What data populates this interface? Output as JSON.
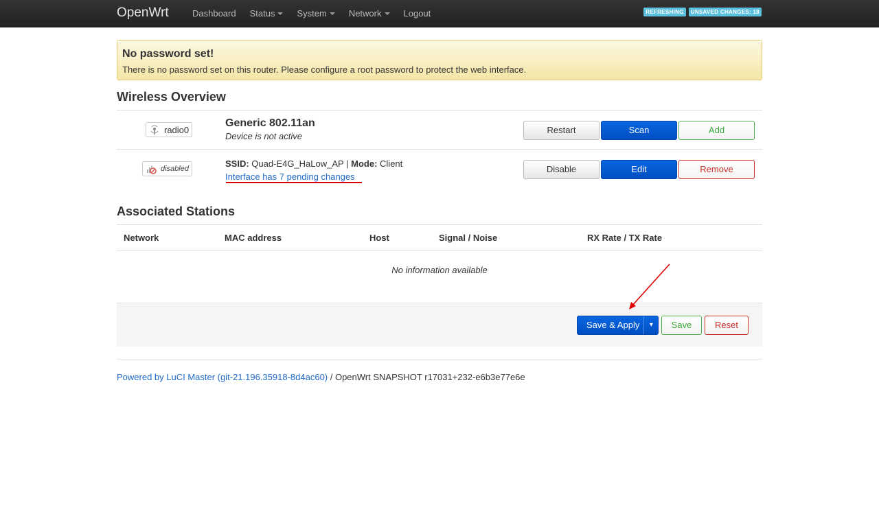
{
  "navbar": {
    "brand": "OpenWrt",
    "items": [
      {
        "label": "Dashboard",
        "dropdown": false
      },
      {
        "label": "Status",
        "dropdown": true
      },
      {
        "label": "System",
        "dropdown": true
      },
      {
        "label": "Network",
        "dropdown": true
      },
      {
        "label": "Logout",
        "dropdown": false
      }
    ],
    "indicators": {
      "refreshing": "REFRESHING",
      "unsaved": "UNSAVED CHANGES: 18"
    }
  },
  "alert": {
    "title": "No password set!",
    "message": "There is no password set on this router. Please configure a root password to protect the web interface."
  },
  "wireless": {
    "heading": "Wireless Overview",
    "radio": {
      "badge": "radio0",
      "title": "Generic 802.11an",
      "status": "Device is not active",
      "buttons": {
        "restart": "Restart",
        "scan": "Scan",
        "add": "Add"
      }
    },
    "iface": {
      "badge": "disabled",
      "ssid_label": "SSID:",
      "ssid": "Quad-E4G_HaLow_AP",
      "sep": "|",
      "mode_label": "Mode:",
      "mode": "Client",
      "pending": "Interface has 7 pending changes",
      "buttons": {
        "disable": "Disable",
        "edit": "Edit",
        "remove": "Remove"
      }
    }
  },
  "stations": {
    "heading": "Associated Stations",
    "columns": [
      "Network",
      "MAC address",
      "Host",
      "Signal / Noise",
      "RX Rate / TX Rate"
    ],
    "empty": "No information available"
  },
  "actions": {
    "save_apply": "Save & Apply",
    "dropdown_glyph": "▾",
    "save": "Save",
    "reset": "Reset"
  },
  "footer": {
    "link": "Powered by LuCI Master (git-21.196.35918-8d4ac60)",
    "text": " / OpenWrt SNAPSHOT r17031+232-e6b3e77e6e"
  },
  "colors": {
    "accent": "#0059d6",
    "annotation": "#e00000",
    "link": "#1e69c7"
  }
}
